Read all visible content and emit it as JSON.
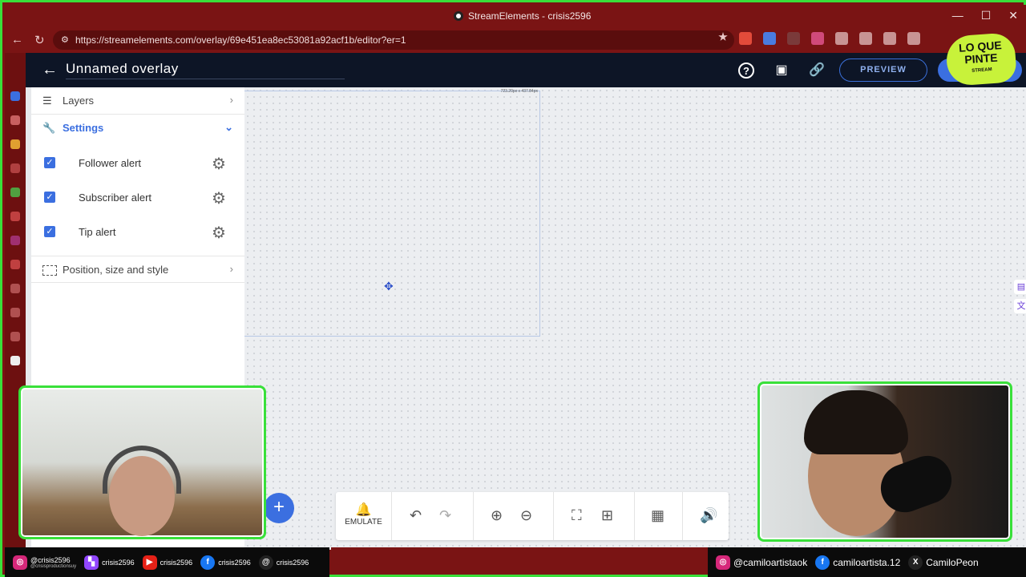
{
  "browser": {
    "window_title": "StreamElements - crisis2596",
    "url": "https://streamelements.com/overlay/69e451ea8ec53081a92acf1b/editor?er=1"
  },
  "app": {
    "title": "Unnamed overlay",
    "preview_label": "PREVIEW"
  },
  "sidebar": {
    "layers_label": "Layers",
    "settings_label": "Settings",
    "alerts": [
      {
        "label": "Follower alert",
        "checked": true
      },
      {
        "label": "Subscriber alert",
        "checked": true
      },
      {
        "label": "Tip alert",
        "checked": true
      }
    ],
    "position_label": "Position, size and style"
  },
  "canvas": {
    "widget_dimensions": "723.20px x 437.84px"
  },
  "toolbar": {
    "emulate_label": "EMULATE",
    "add_label": "+"
  },
  "overlay": {
    "brand_text": "LO QUE PINTE",
    "brand_sub": "STREAM",
    "social_left": [
      {
        "icon": "instagram-icon",
        "text": "@crisis2596",
        "sub": "@crisisproductionsuy",
        "color": "#d6287a"
      },
      {
        "icon": "twitch-icon",
        "text": "crisis2596",
        "color": "#9146ff"
      },
      {
        "icon": "youtube-icon",
        "text": "crisis2596",
        "color": "#e62117"
      },
      {
        "icon": "facebook-icon",
        "text": "crisis2596",
        "color": "#1877f2"
      },
      {
        "icon": "threads-icon",
        "text": "crisis2596",
        "color": "#222222"
      }
    ],
    "social_right": [
      {
        "icon": "instagram-icon",
        "text": "@camiloartistaok",
        "color": "#d6287a"
      },
      {
        "icon": "facebook-icon",
        "text": "camiloartista.12",
        "color": "#1877f2"
      },
      {
        "icon": "x-icon",
        "text": "CamiloPeon",
        "color": "#222222"
      }
    ]
  },
  "colors": {
    "frame": "#39e03a",
    "browser": "#7a1414",
    "accent": "#3b6fe0",
    "appbar": "#0d1526"
  }
}
